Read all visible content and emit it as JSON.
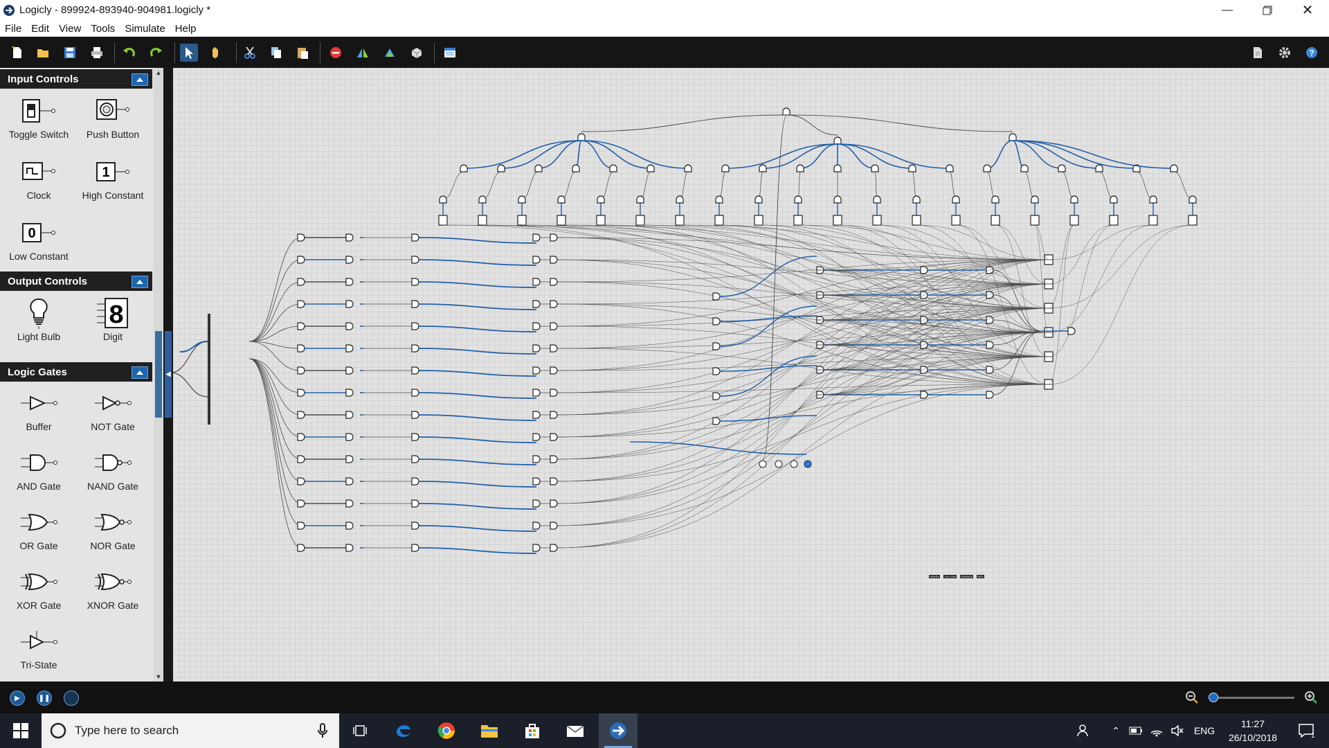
{
  "window": {
    "title": "Logicly - 899924-893940-904981.logicly *",
    "controls": [
      "minimize-icon",
      "restore-icon",
      "close-icon"
    ]
  },
  "menu": [
    "File",
    "Edit",
    "View",
    "Tools",
    "Simulate",
    "Help"
  ],
  "toolbar": {
    "buttons": [
      "new-file-icon",
      "open-folder-icon",
      "save-icon",
      "print-icon",
      "undo-icon",
      "redo-icon",
      "select-pointer-icon",
      "pan-hand-icon",
      "cut-icon",
      "copy-icon",
      "paste-icon",
      "delete-icon",
      "flip-horizontal-icon",
      "flip-vertical-icon",
      "integrated-circuit-icon",
      "properties-icon",
      "export-icon",
      "settings-gear-icon",
      "help-icon"
    ],
    "active": "select-pointer-icon"
  },
  "sidebar": {
    "input_controls": {
      "title": "Input Controls",
      "items": [
        {
          "label": "Toggle Switch",
          "icon": "toggle-switch-icon"
        },
        {
          "label": "Push Button",
          "icon": "push-button-icon"
        },
        {
          "label": "Clock",
          "icon": "clock-icon"
        },
        {
          "label": "High Constant",
          "icon": "high-constant-icon",
          "glyph": "1"
        },
        {
          "label": "Low Constant",
          "icon": "low-constant-icon",
          "glyph": "0"
        }
      ]
    },
    "output_controls": {
      "title": "Output Controls",
      "items": [
        {
          "label": "Light Bulb",
          "icon": "light-bulb-icon"
        },
        {
          "label": "Digit",
          "icon": "digit-icon",
          "glyph": "8"
        }
      ]
    },
    "logic_gates": {
      "title": "Logic Gates",
      "items": [
        {
          "label": "Buffer",
          "icon": "buffer-gate-icon"
        },
        {
          "label": "NOT Gate",
          "icon": "not-gate-icon"
        },
        {
          "label": "AND Gate",
          "icon": "and-gate-icon"
        },
        {
          "label": "NAND Gate",
          "icon": "nand-gate-icon"
        },
        {
          "label": "OR Gate",
          "icon": "or-gate-icon"
        },
        {
          "label": "NOR Gate",
          "icon": "nor-gate-icon"
        },
        {
          "label": "XOR Gate",
          "icon": "xor-gate-icon"
        },
        {
          "label": "XNOR Gate",
          "icon": "xnor-gate-icon"
        },
        {
          "label": "Tri-State",
          "icon": "tri-state-icon"
        }
      ]
    }
  },
  "canvas": {
    "wire_colors": {
      "low": "#4a4a4a",
      "high": "#1f5fa8"
    },
    "bottom_labels": [
      "GREEN",
      "YELLOW",
      "ORANGE",
      "RED"
    ]
  },
  "simulation": {
    "buttons": [
      "step-icon",
      "pause-icon",
      "status-indicator-icon"
    ],
    "zoom_level": 0.0
  },
  "taskbar": {
    "search_placeholder": "Type here to search",
    "apps": [
      "task-view-icon",
      "edge-icon",
      "chrome-icon",
      "file-explorer-icon",
      "store-icon",
      "mail-icon",
      "logicly-icon"
    ],
    "language": "ENG",
    "time": "11:27",
    "date": "26/10/2018",
    "notifications": "1"
  }
}
